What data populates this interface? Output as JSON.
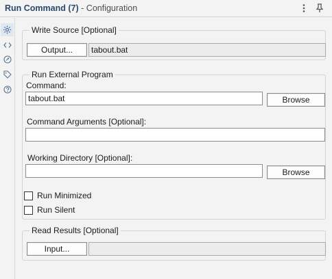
{
  "header": {
    "tool_name": "Run Command",
    "tool_count": "(7)",
    "separator": "-",
    "subtitle": "Configuration"
  },
  "icons": {
    "menu": "more-vertical-icon",
    "pin": "pin-icon",
    "rail": [
      "gear-icon",
      "code-icon",
      "rename-icon",
      "tag-icon",
      "help-icon"
    ]
  },
  "write_source": {
    "legend": "Write Source [Optional]",
    "output_button": "Output...",
    "output_value": "tabout.bat"
  },
  "external": {
    "legend": "Run External Program",
    "command_label": "Command:",
    "command_value": "tabout.bat",
    "browse_button": "Browse",
    "args_label": "Command Arguments [Optional]:",
    "args_value": "",
    "workdir_label": "Working Directory [Optional]:",
    "workdir_value": "",
    "workdir_browse": "Browse",
    "run_minimized_label": "Run Minimized",
    "run_minimized_checked": false,
    "run_silent_label": "Run Silent",
    "run_silent_checked": false
  },
  "read_results": {
    "legend": "Read Results [Optional]",
    "input_button": "Input...",
    "input_value": ""
  },
  "colors": {
    "accent": "#2b4a6b",
    "active_rail": "#dfe8f1",
    "icon": "#5a7391"
  }
}
